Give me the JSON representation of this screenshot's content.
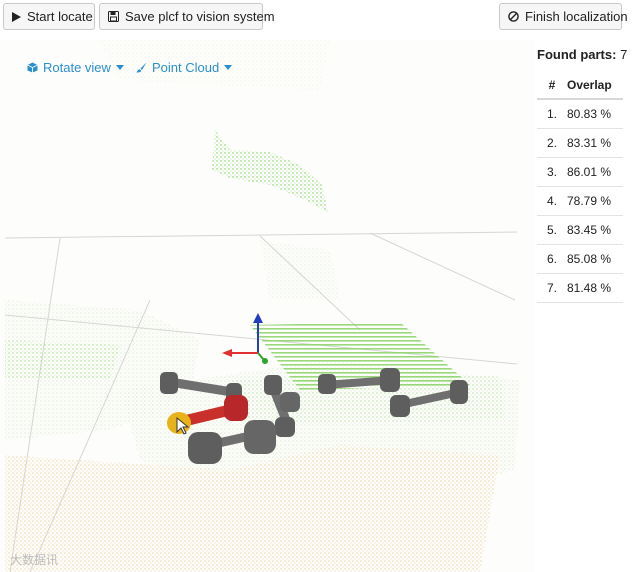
{
  "toolbar": {
    "start_locate": "Start locate",
    "save_plcf": "Save plcf to vision system",
    "finish_localization": "Finish localization"
  },
  "view": {
    "rotate_view": "Rotate view",
    "point_cloud": "Point Cloud"
  },
  "results": {
    "found_label": "Found parts:",
    "found_count": "7",
    "columns": [
      "#",
      "Overlap"
    ],
    "rows": [
      {
        "n": "1.",
        "overlap": "80.83 %"
      },
      {
        "n": "2.",
        "overlap": "83.31 %"
      },
      {
        "n": "3.",
        "overlap": "86.01 %"
      },
      {
        "n": "4.",
        "overlap": "78.79 %"
      },
      {
        "n": "5.",
        "overlap": "83.45 %"
      },
      {
        "n": "6.",
        "overlap": "85.08 %"
      },
      {
        "n": "7.",
        "overlap": "81.48 %"
      }
    ]
  },
  "watermark": "大数据讯",
  "colors": {
    "accent": "#2b8fcf",
    "point_cloud_green": "#6fcf4a",
    "part_gray": "#6b6b6b",
    "selected_part": "#c9302c",
    "axis_x": "#e03030",
    "axis_y": "#2aa52a",
    "axis_z": "#2040c0"
  },
  "icons": [
    "play-icon",
    "save-icon",
    "ban-icon",
    "cube-icon",
    "brush-icon",
    "caret-down-icon",
    "cursor-icon"
  ]
}
